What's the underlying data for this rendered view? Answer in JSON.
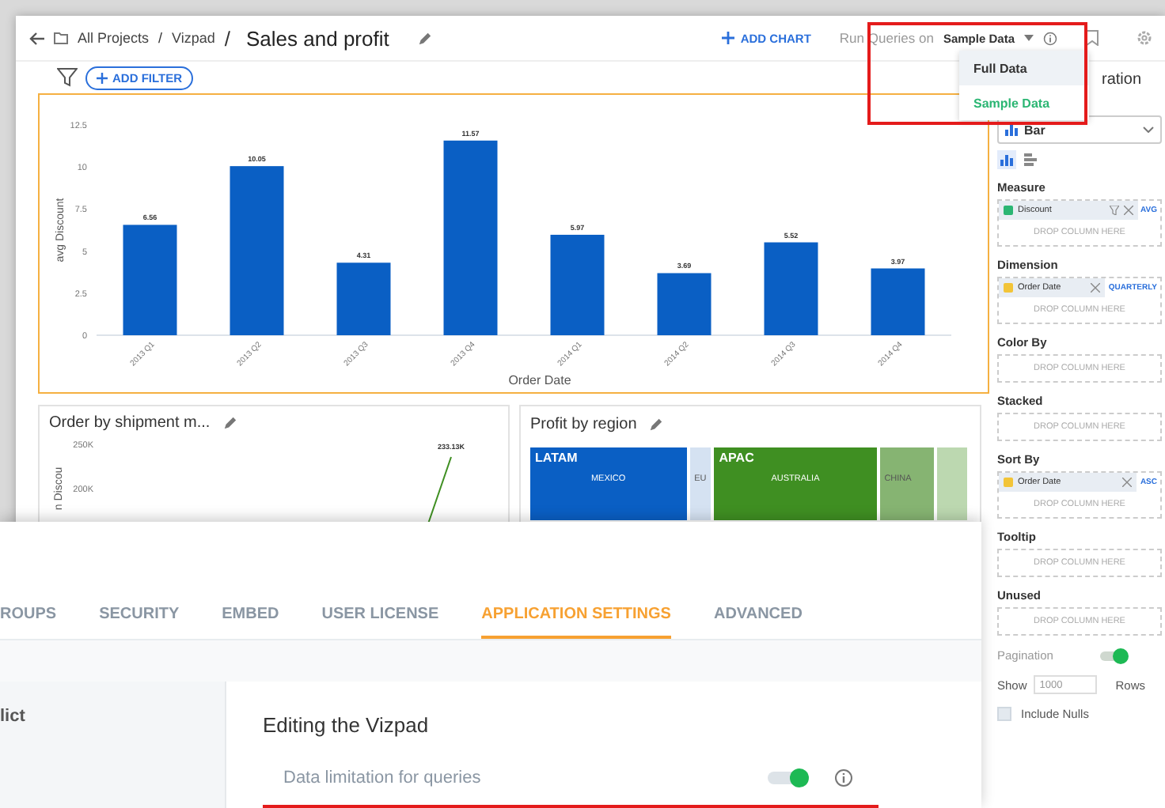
{
  "header": {
    "breadcrumbs": [
      {
        "kind": "link",
        "text": "All Projects"
      },
      {
        "kind": "separator",
        "text": "/"
      },
      {
        "kind": "link",
        "text": "Vizpad"
      },
      {
        "kind": "separator",
        "text": "/"
      }
    ],
    "title": "Sales and profit",
    "add_chart": "ADD CHART",
    "run_queries_label": "Run Queries on",
    "data_mode": "Sample Data"
  },
  "add_filter": "ADD FILTER",
  "data_menu": [
    {
      "label": "Full Data",
      "selected": false,
      "highlighted": true
    },
    {
      "label": "Sample Data",
      "selected": true,
      "highlighted": false
    }
  ],
  "main_chart": {
    "chart_data": {
      "type": "bar",
      "xlabel": "Order Date",
      "ylabel": "avg Discount",
      "categories": [
        "2013 Q1",
        "2013 Q2",
        "2013 Q3",
        "2013 Q4",
        "2014 Q1",
        "2014 Q2",
        "2014 Q3",
        "2014 Q4"
      ],
      "values": [
        6.56,
        10.05,
        4.31,
        11.57,
        5.97,
        3.69,
        5.52,
        3.97
      ],
      "ylim": [
        0,
        12.5
      ],
      "yticks": [
        0,
        2.5,
        5,
        7.5,
        10,
        12.5
      ],
      "value_labels": [
        "6.56",
        "10.05",
        "4.31",
        "11.57",
        "5.97",
        "3.69",
        "5.52",
        "3.97"
      ]
    }
  },
  "shipment_card": {
    "title": "Order by shipment m...",
    "y_ticks": [
      "250K",
      "200K"
    ],
    "axis_label": "n Discou",
    "point_label": "233.13K"
  },
  "region_card": {
    "title": "Profit by region",
    "tiles": [
      {
        "label": "LATAM",
        "sublabel": "MEXICO",
        "color": "#0a5fc4"
      },
      {
        "sublabel": "EU",
        "color": "#d5e2f2"
      },
      {
        "label": "APAC",
        "sublabel": "AUSTRALIA",
        "color": "#3f8f22"
      },
      {
        "sublabel": "CHINA",
        "color": "#86b472"
      },
      {
        "color": "#bcd8b0"
      }
    ]
  },
  "config_panel": {
    "title": "ration",
    "chart_type": "Bar",
    "type_toggles": [
      {
        "kind": "column",
        "selected": true
      },
      {
        "kind": "bar",
        "selected": false
      }
    ],
    "sections": [
      {
        "title": "Measure",
        "pills": [
          {
            "label": "Discount",
            "color": "#2bb673",
            "filter": true,
            "action": "AVG"
          }
        ],
        "drop_hint": "DROP COLUMN HERE"
      },
      {
        "title": "Dimension",
        "pills": [
          {
            "label": "Order Date",
            "color": "#f2c438",
            "filter": false,
            "action": "QUARTERLY"
          }
        ],
        "drop_hint": "DROP COLUMN HERE"
      },
      {
        "title": "Color By",
        "drop_hint": "DROP COLUMN HERE"
      },
      {
        "title": "Stacked",
        "drop_hint": "DROP COLUMN HERE"
      },
      {
        "title": "Sort By",
        "pills": [
          {
            "label": "Order Date",
            "color": "#f2c438",
            "filter": false,
            "action": "ASC"
          }
        ],
        "drop_hint": "DROP COLUMN HERE"
      },
      {
        "title": "Tooltip",
        "drop_hint": "DROP COLUMN HERE"
      },
      {
        "title": "Unused",
        "drop_hint": "DROP COLUMN HERE"
      }
    ],
    "pagination": {
      "label": "Pagination",
      "on": true
    },
    "show": {
      "label": "Show",
      "value": "1000",
      "suffix": "Rows"
    },
    "include_nulls": {
      "label": "Include Nulls",
      "checked": false
    }
  },
  "settings_window": {
    "tabs": [
      {
        "label": "ROUPS",
        "selected": false
      },
      {
        "label": "SECURITY",
        "selected": false
      },
      {
        "label": "EMBED",
        "selected": false
      },
      {
        "label": "USER LICENSE",
        "selected": false
      },
      {
        "label": "APPLICATION SETTINGS",
        "selected": true
      },
      {
        "label": "ADVANCED",
        "selected": false
      }
    ],
    "sidebar_text": "lict",
    "section_title": "Editing the Vizpad",
    "setting": {
      "label": "Data limitation for queries",
      "on": true
    }
  }
}
